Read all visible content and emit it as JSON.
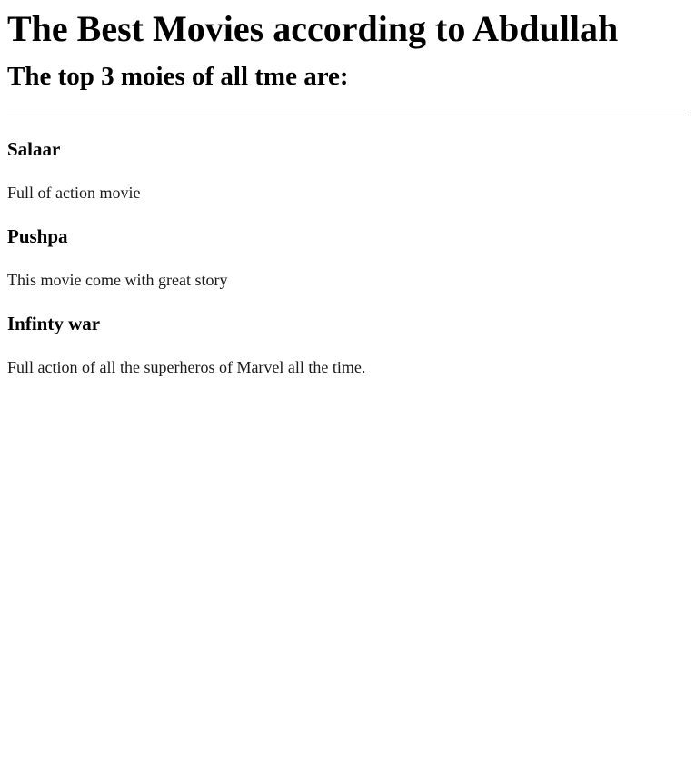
{
  "page": {
    "title": "The Best Movies according to Abdullah",
    "subtitle": "The top 3 moies of all tme are:"
  },
  "movies": [
    {
      "title": "Salaar",
      "description": "Full of action movie"
    },
    {
      "title": "Pushpa",
      "description": "This movie come with great story"
    },
    {
      "title": "Infinty war",
      "description": "Full action of all the superheros of Marvel all the time."
    }
  ]
}
